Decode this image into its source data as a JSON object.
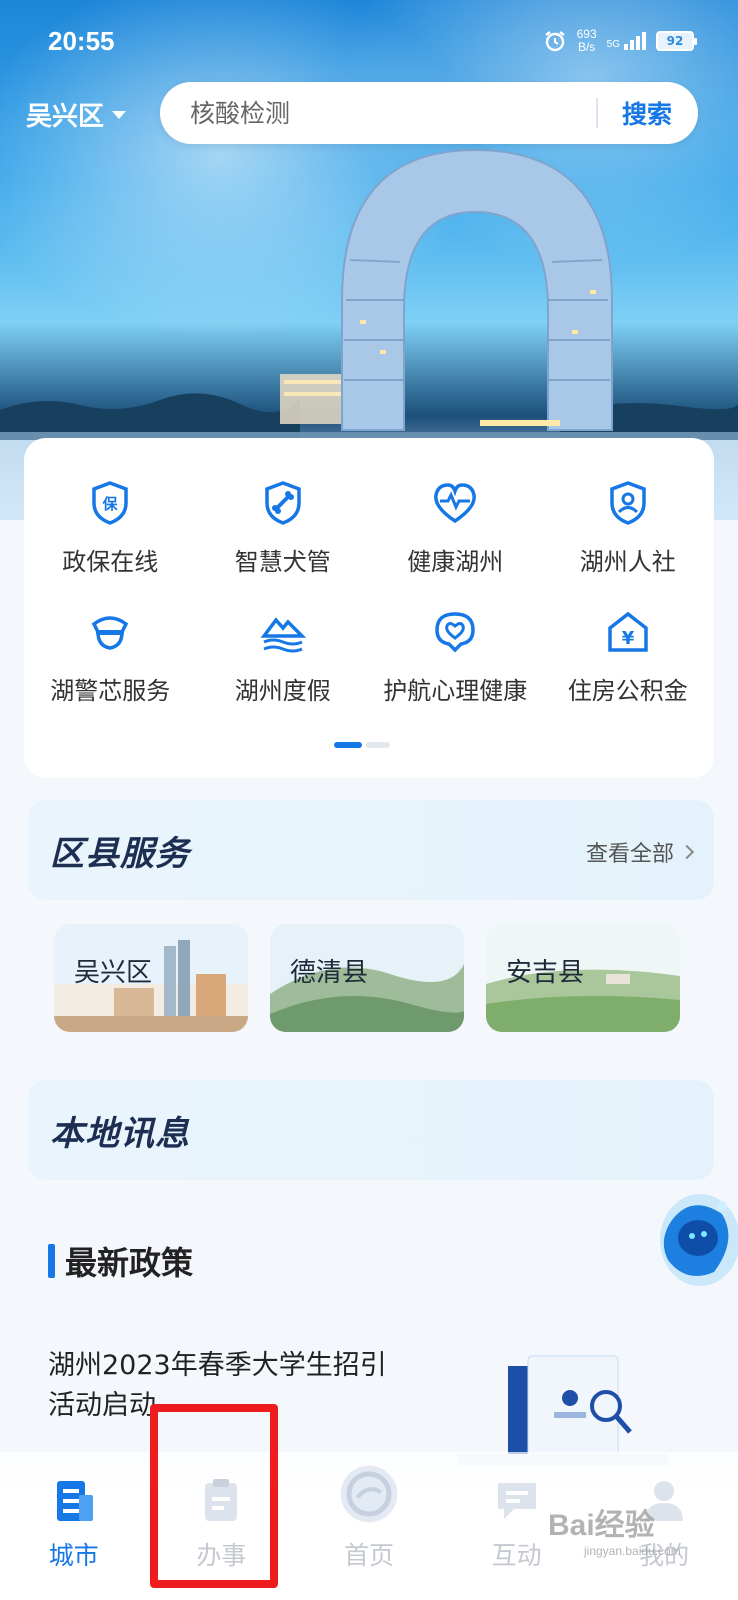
{
  "status_bar": {
    "time": "20:55",
    "net_speed_value": "693",
    "net_speed_unit": "B/s",
    "network": "5G",
    "battery": "92"
  },
  "header": {
    "region": "吴兴区",
    "search_placeholder": "核酸检测",
    "search_button": "搜索"
  },
  "services": [
    {
      "label": "政保在线",
      "icon": "shield-bao-icon"
    },
    {
      "label": "智慧犬管",
      "icon": "dog-bone-icon"
    },
    {
      "label": "健康湖州",
      "icon": "heart-pulse-icon"
    },
    {
      "label": "湖州人社",
      "icon": "person-shield-icon"
    },
    {
      "label": "湖警芯服务",
      "icon": "police-cap-icon"
    },
    {
      "label": "湖州度假",
      "icon": "mountain-wave-icon"
    },
    {
      "label": "护航心理健康",
      "icon": "heart-chat-icon"
    },
    {
      "label": "住房公积金",
      "icon": "house-yen-icon"
    }
  ],
  "district_section": {
    "title": "区县服务",
    "view_all": "查看全部",
    "districts": [
      {
        "name": "吴兴区"
      },
      {
        "name": "德清县"
      },
      {
        "name": "安吉县"
      }
    ]
  },
  "news_section": {
    "title": "本地讯息",
    "policy_heading": "最新政策",
    "article": {
      "title": "湖州2023年春季大学生招引活动启动"
    }
  },
  "bottom_nav": [
    {
      "label": "城市",
      "icon": "city-icon",
      "active": true
    },
    {
      "label": "办事",
      "icon": "clipboard-icon",
      "active": false
    },
    {
      "label": "首页",
      "icon": "home-logo-icon",
      "active": false
    },
    {
      "label": "互动",
      "icon": "chat-icon",
      "active": false
    },
    {
      "label": "我的",
      "icon": "profile-icon",
      "active": false
    }
  ],
  "watermark": {
    "text": "Bai经验",
    "sub": "jingyan.baidu.com"
  },
  "colors": {
    "accent": "#1677e6",
    "highlight": "#ee1c1c",
    "inactive": "#c4c9d1"
  }
}
